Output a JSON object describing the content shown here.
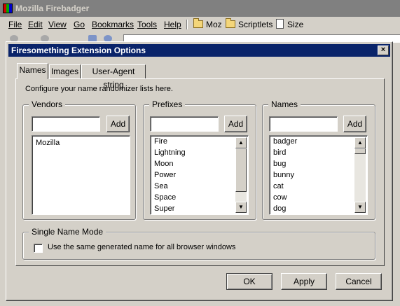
{
  "browser": {
    "title": "Mozilla Firebadger",
    "menu": [
      "File",
      "Edit",
      "View",
      "Go",
      "Bookmarks",
      "Tools",
      "Help"
    ],
    "bookmarks": [
      "Moz",
      "Scriptlets",
      "Size"
    ]
  },
  "dialog": {
    "title": "Firesomething Extension Options",
    "close_label": "×",
    "tabs": [
      "Names",
      "Images",
      "User-Agent string"
    ],
    "intro": "Configure your name randomizer lists here.",
    "vendors": {
      "legend": "Vendors",
      "add_label": "Add",
      "items": [
        "Mozilla"
      ]
    },
    "prefixes": {
      "legend": "Prefixes",
      "add_label": "Add",
      "items": [
        "Fire",
        "Lightning",
        "Moon",
        "Power",
        "Sea",
        "Space",
        "Super"
      ]
    },
    "names": {
      "legend": "Names",
      "add_label": "Add",
      "items": [
        "badger",
        "bird",
        "bug",
        "bunny",
        "cat",
        "cow",
        "dog"
      ]
    },
    "single_mode": {
      "legend": "Single Name Mode",
      "checkbox_label": "Use the same generated name for all browser windows",
      "checked": false
    },
    "buttons": {
      "ok": "OK",
      "apply": "Apply",
      "cancel": "Cancel"
    }
  }
}
